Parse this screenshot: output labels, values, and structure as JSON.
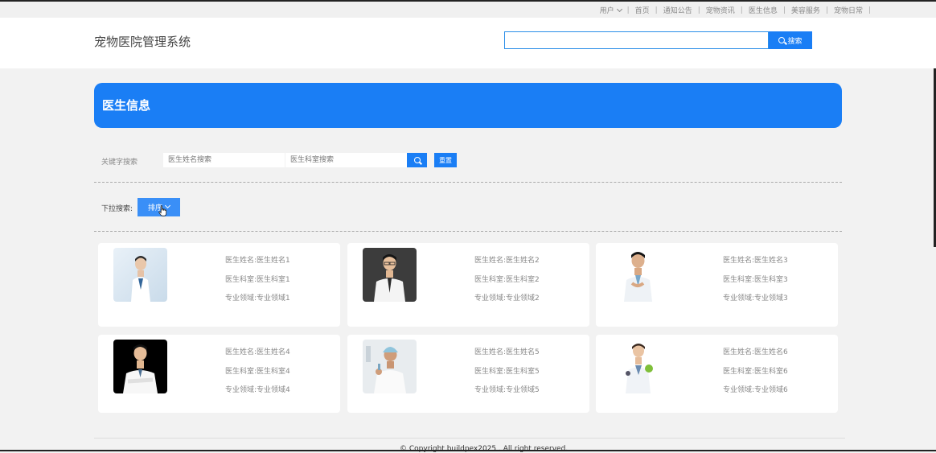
{
  "topnav": {
    "user": "用户",
    "items": [
      "首页",
      "通知公告",
      "宠物资讯",
      "医生信息",
      "美容服务",
      "宠物日常"
    ],
    "active_index": 3
  },
  "header": {
    "site_title": "宠物医院管理系统",
    "search_value": "",
    "search_button": "搜索"
  },
  "banner": {
    "title": "医生信息"
  },
  "filter": {
    "keyword_label": "关键字搜索",
    "name_placeholder": "医生姓名搜索",
    "dept_placeholder": "医生科室搜索",
    "reset_label": "重置",
    "dropdown_label": "下拉搜索:",
    "sort_label": "排序"
  },
  "doctors": [
    {
      "name": "医生姓名:医生姓名1",
      "dept": "医生科室:医生科室1",
      "field": "专业领域:专业领域1"
    },
    {
      "name": "医生姓名:医生姓名2",
      "dept": "医生科室:医生科室2",
      "field": "专业领域:专业领域2"
    },
    {
      "name": "医生姓名:医生姓名3",
      "dept": "医生科室:医生科室3",
      "field": "专业领域:专业领域3"
    },
    {
      "name": "医生姓名:医生姓名4",
      "dept": "医生科室:医生科室4",
      "field": "专业领域:专业领域4"
    },
    {
      "name": "医生姓名:医生姓名5",
      "dept": "医生科室:医生科室5",
      "field": "专业领域:专业领域5"
    },
    {
      "name": "医生姓名:医生姓名6",
      "dept": "医生科室:医生科室6",
      "field": "专业领域:专业领域6"
    }
  ],
  "footer": {
    "copyright": "© Copyright buildpex2025 . All right reserved."
  },
  "colors": {
    "primary": "#1a7ef5",
    "active_underline": "#3aa372"
  }
}
